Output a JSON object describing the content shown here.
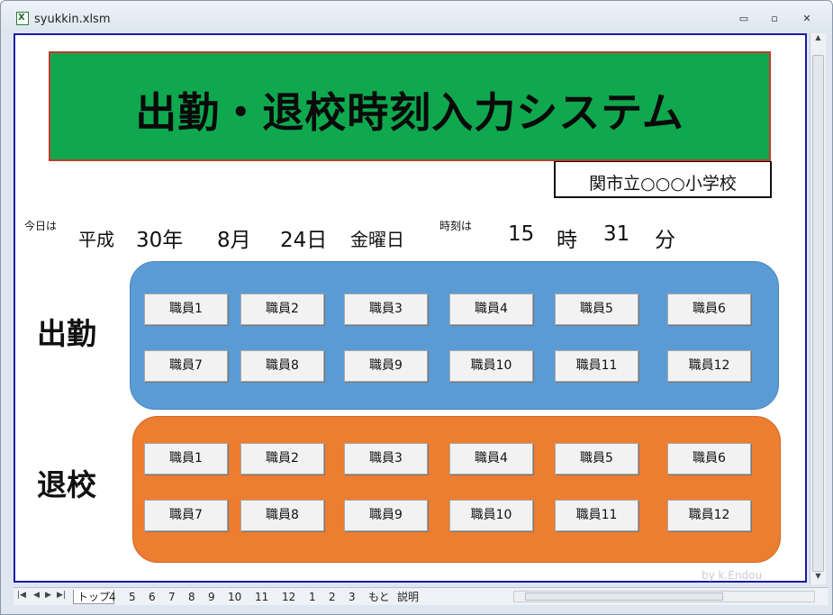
{
  "window": {
    "title": "syukkin.xlsm",
    "minimize_glyph": "▭",
    "restore_glyph": "▫",
    "close_glyph": "✕"
  },
  "banner": {
    "title": "出勤・退校時刻入力システム",
    "school": "関市立○○○小学校",
    "fill_color": "#0fa84e"
  },
  "datetime": {
    "today_label": "今日は",
    "era": "平成",
    "year": "30年",
    "month": "8月",
    "day": "24日",
    "weekday": "金曜日",
    "time_label": "時刻は",
    "hour": "15",
    "hour_unit": "時",
    "minute": "31",
    "minute_unit": "分"
  },
  "attendance": {
    "label": "出勤",
    "color": "#5b9bd5",
    "buttons": [
      "職員1",
      "職員2",
      "職員3",
      "職員4",
      "職員5",
      "職員6",
      "職員7",
      "職員8",
      "職員9",
      "職員10",
      "職員11",
      "職員12"
    ]
  },
  "leave": {
    "label": "退校",
    "color": "#ed7d31",
    "buttons": [
      "職員1",
      "職員2",
      "職員3",
      "職員4",
      "職員5",
      "職員6",
      "職員7",
      "職員8",
      "職員9",
      "職員10",
      "職員11",
      "職員12"
    ]
  },
  "credit": "by k.Endou",
  "sheet_tabs": [
    "トップ",
    "4",
    "5",
    "6",
    "7",
    "8",
    "9",
    "10",
    "11",
    "12",
    "1",
    "2",
    "3",
    "もと",
    "説明"
  ],
  "active_tab": "トップ"
}
